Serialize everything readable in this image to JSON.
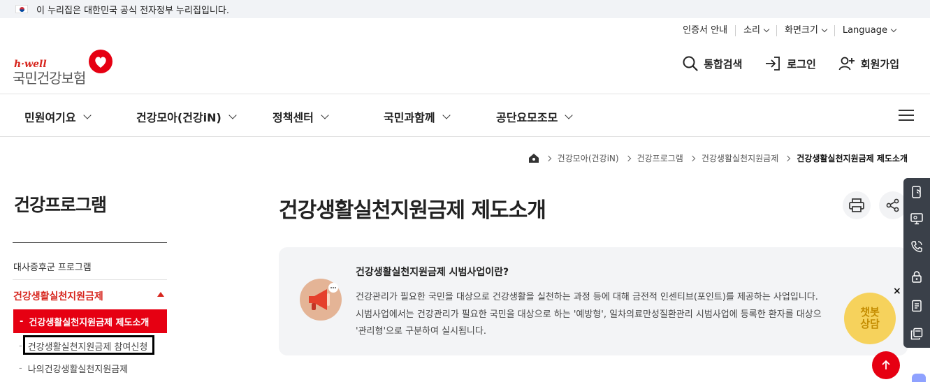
{
  "gov_banner": {
    "text": "이 누리집은 대한민국 공식 전자정부 누리집입니다."
  },
  "utility": {
    "cert": "인증서 안내",
    "sound": "소리",
    "screen_size": "화면크기",
    "language": "Language"
  },
  "logo": {
    "brand": "h·well",
    "name": "국민건강보험"
  },
  "actions": {
    "search": "통합검색",
    "login": "로그인",
    "signup": "회원가입"
  },
  "gnb": {
    "items": [
      {
        "label": "민원여기요"
      },
      {
        "label": "건강모아(건강iN)"
      },
      {
        "label": "정책센터"
      },
      {
        "label": "국민과함께"
      },
      {
        "label": "공단요모조모"
      }
    ]
  },
  "breadcrumb": {
    "items": [
      "건강모아(건강iN)",
      "건강프로그램",
      "건강생활실천지원금제"
    ],
    "current": "건강생활실천지원금제 제도소개"
  },
  "sidebar": {
    "title": "건강프로그램",
    "item_metabolic": "대사증후군 프로그램",
    "active_group": "건강생활실천지원금제",
    "dash": "-",
    "sub_current": "건강생활실천지원금제 제도소개",
    "sub_apply": "건강생활실천지원금제 참여신청",
    "sub_mine": "나의건강생활실천지원금제"
  },
  "main": {
    "title": "건강생활실천지원금제 제도소개"
  },
  "info": {
    "heading": "건강생활실천지원금제 시범사업이란?",
    "line1": "건강관리가 필요한 국민을 대상으로 건강생활을 실천하는 과정 등에 대해 금전적 인센티브(포인트)를 제공하는 사업입니다.",
    "line2": "시범사업에서는 건강관리가 필요한 국민을 대상으로 하는 '예방형', 일차의료만성질환관리 시범사업에 등록한 환자를 대상으",
    "line3": "'관리형'으로 구분하여 실시됩니다."
  },
  "chatbot": {
    "line1": "챗봇",
    "line2": "상담",
    "close": "×"
  },
  "colors": {
    "brand_red": "#e60012",
    "quick_bg": "#3a4049",
    "chatbot": "#f6d25c"
  }
}
